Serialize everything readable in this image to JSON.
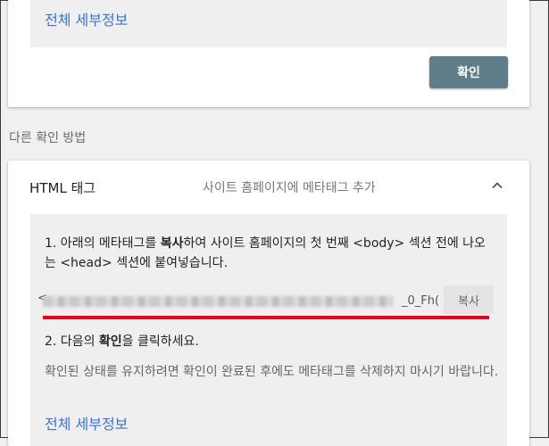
{
  "top_card": {
    "details_link": "전체 세부정보",
    "confirm_button": "확인"
  },
  "other_methods_label": "다른 확인 방법",
  "html_tag_section": {
    "title": "HTML 태그",
    "description": "사이트 홈페이지에 메타태그 추가",
    "step1": {
      "prefix": "1. 아래의 메타태그를 ",
      "bold": "복사",
      "suffix": "하여 사이트 홈페이지의 첫 번째 <body> 섹션 전에 나오는 <head> 섹션에 붙여넣습니다."
    },
    "meta_tag_code_start": "<",
    "meta_tag_code_end": "_0_Fh(",
    "copy_button": "복사",
    "step2": {
      "prefix": "2. 다음의 ",
      "bold": "확인",
      "suffix": "을 클릭하세요."
    },
    "note": "확인된 상태를 유지하려면 확인이 완료된 후에도 메타태그를 삭제하지 마시기 바랍니다.",
    "details_link": "전체 세부정보"
  },
  "colors": {
    "link": "#3b73d6",
    "confirm_button_bg": "#607d8b",
    "highlight_line": "#e8001c"
  },
  "icons": {
    "collapse": "chevron-up-icon"
  }
}
